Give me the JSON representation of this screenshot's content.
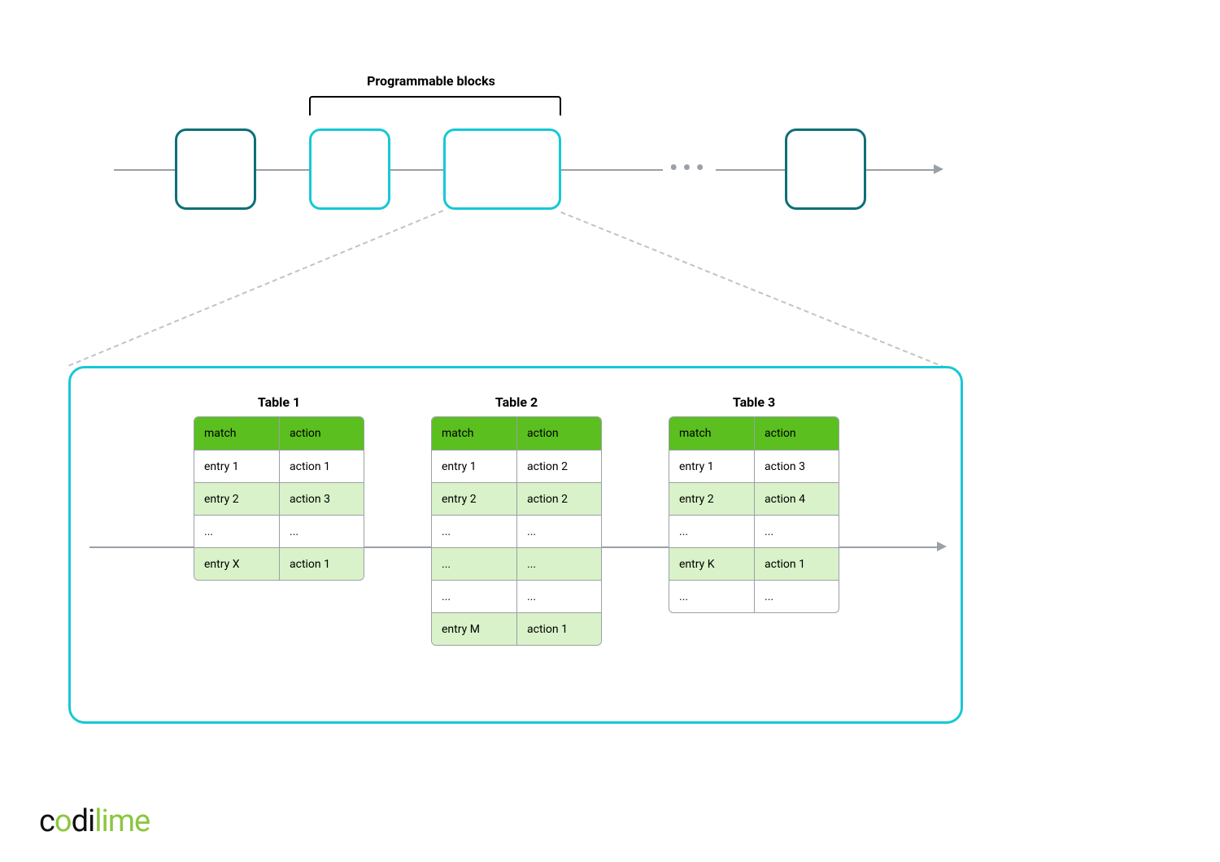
{
  "bracket_label": "Programmable blocks",
  "ellipsis": "•••",
  "tables": [
    {
      "title": "Table 1",
      "header": {
        "match": "match",
        "action": "action"
      },
      "rows": [
        {
          "m": "entry 1",
          "a": "action 1",
          "alt": false
        },
        {
          "m": "entry 2",
          "a": "action 3",
          "alt": true
        },
        {
          "m": "...",
          "a": "...",
          "alt": false
        },
        {
          "m": "entry X",
          "a": "action 1",
          "alt": true
        }
      ]
    },
    {
      "title": "Table 2",
      "header": {
        "match": "match",
        "action": "action"
      },
      "rows": [
        {
          "m": "entry 1",
          "a": "action 2",
          "alt": false
        },
        {
          "m": "entry 2",
          "a": "action 2",
          "alt": true
        },
        {
          "m": "...",
          "a": "...",
          "alt": false
        },
        {
          "m": "...",
          "a": "...",
          "alt": true
        },
        {
          "m": "...",
          "a": "...",
          "alt": false
        },
        {
          "m": "entry M",
          "a": "action 1",
          "alt": true
        }
      ]
    },
    {
      "title": "Table 3",
      "header": {
        "match": "match",
        "action": "action"
      },
      "rows": [
        {
          "m": "entry 1",
          "a": "action 3",
          "alt": false
        },
        {
          "m": "entry 2",
          "a": "action 4",
          "alt": true
        },
        {
          "m": "...",
          "a": "...",
          "alt": false
        },
        {
          "m": "entry K",
          "a": "action 1",
          "alt": true
        },
        {
          "m": "...",
          "a": "...",
          "alt": false
        }
      ]
    }
  ],
  "logo": {
    "part1": "c",
    "dot": "o",
    "part2": "di",
    "part3": "lime"
  },
  "colors": {
    "dark_teal": "#0e6f77",
    "cyan": "#16c8d6",
    "header_green": "#5bbf1f",
    "alt_green": "#d9f2c9",
    "line_gray": "#9aa0a6",
    "lime": "#8cc63f"
  }
}
